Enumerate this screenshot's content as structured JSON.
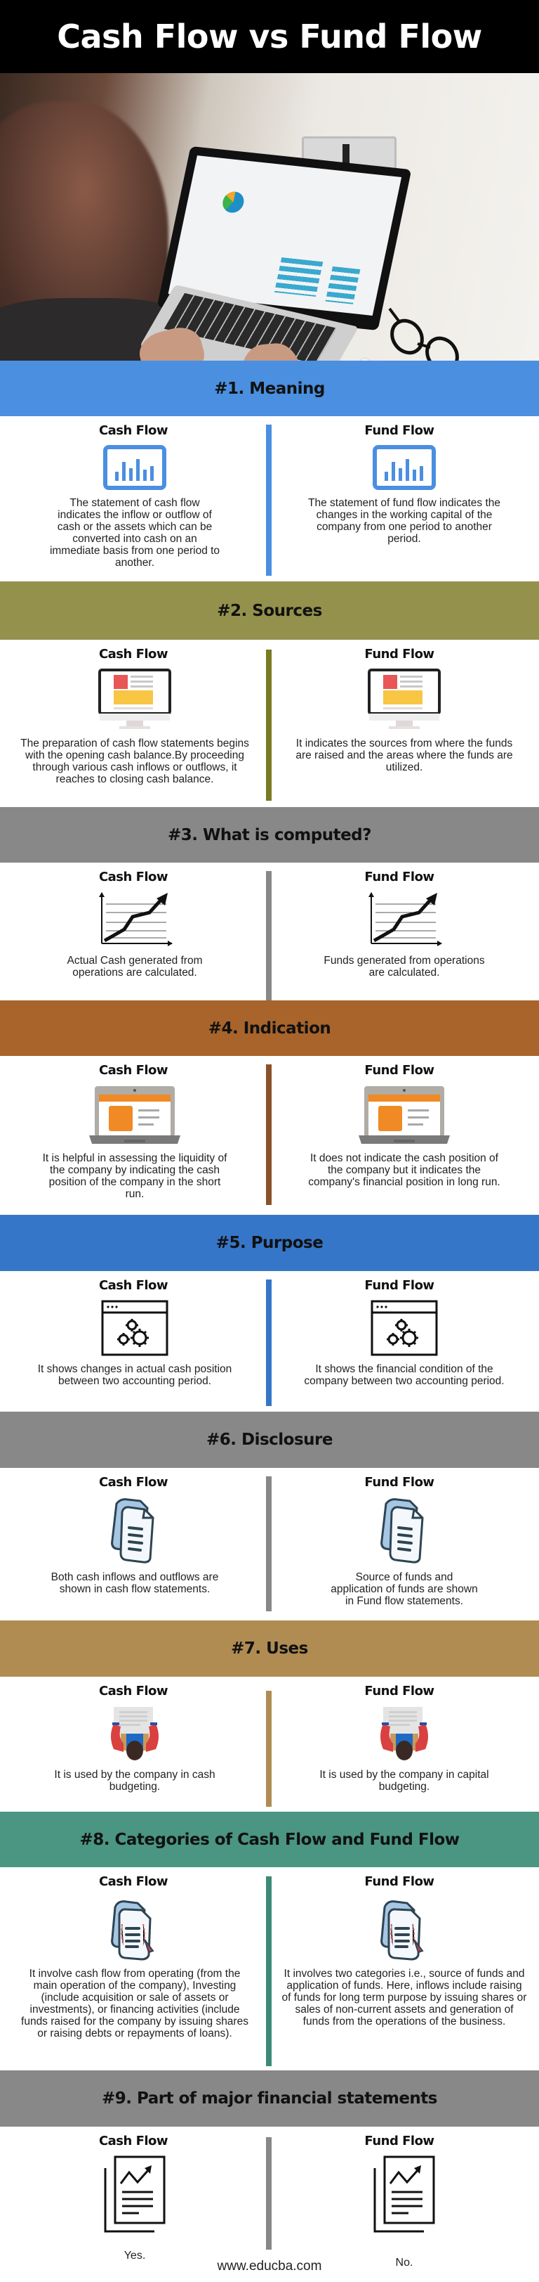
{
  "title": "Cash Flow vs Fund Flow",
  "photo": {
    "description": "person typing on laptop showing analytics dashboard",
    "icon": "hero-photo"
  },
  "column_titles": {
    "left": "Cash Flow",
    "right": "Fund Flow"
  },
  "sections": [
    {
      "heading": "#1. Meaning",
      "color": "#4a8fe0",
      "icon": "bar-chart-icon",
      "left_text": "The statement of cash flow indicates the inflow or outflow of cash or the assets which can be converted into cash on an immediate basis from one period to another.",
      "right_text": "The statement of fund flow indicates the changes in the working capital of the company from one period to another period."
    },
    {
      "heading": "#2. Sources",
      "color": "#94914c",
      "divider_color": "#7a7a22",
      "icon": "monitor-icon",
      "left_text": "The preparation of cash flow statements begins with the opening cash balance.By proceeding through various cash inflows or outflows, it reaches to closing cash balance.",
      "right_text": "It indicates the sources from where the funds are raised and the areas where the funds are utilized."
    },
    {
      "heading": "#3. What is computed?",
      "color": "#888888",
      "icon": "growth-chart-icon",
      "left_text": "Actual Cash generated from operations are calculated.",
      "right_text": "Funds generated from operations are calculated."
    },
    {
      "heading": "#4. Indication",
      "color": "#a8642a",
      "divider_color": "#8a5228",
      "icon": "laptop-icon",
      "left_text": "It is helpful in assessing the liquidity of the company by indicating the cash position of the company in the short run.",
      "right_text": "It does not indicate the cash position of the company but it indicates the company's financial position in long run."
    },
    {
      "heading": "#5. Purpose",
      "color": "#3576c8",
      "icon": "gears-window-icon",
      "left_text": "It shows changes in actual cash position between two accounting period.",
      "right_text": "It shows the financial condition of the company between two accounting period."
    },
    {
      "heading": "#6. Disclosure",
      "color": "#888888",
      "icon": "documents-icon",
      "left_text": "Both cash inflows and outflows are shown in cash flow statements.",
      "right_text": "Source of funds and application of funds are shown in Fund flow statements."
    },
    {
      "heading": "#7. Uses",
      "color": "#b08c52",
      "icon": "person-at-desk-icon",
      "left_text": "It is used by the company in cash budgeting.",
      "right_text": "It is used by the company in capital budgeting."
    },
    {
      "heading": "#8. Categories of Cash Flow and Fund Flow",
      "color": "#4a9682",
      "divider_color": "#3d8a78",
      "icon": "document-edit-icon",
      "left_text": "It involve cash flow from operating (from the main operation of the company), Investing (include acquisition or sale of assets or investments), or financing activities (include funds raised for the company by issuing shares or raising debts or repayments of loans).",
      "right_text": "It involves two categories i.e., source of funds and application of funds. Here, inflows include raising of funds for long term purpose by issuing shares or sales of non-current assets and generation of funds from the operations of the business."
    },
    {
      "heading": "#9. Part of major financial statements",
      "color": "#888888",
      "icon": "report-icon",
      "left_text": "Yes.",
      "right_text": "No."
    }
  ],
  "footer": {
    "url": "www.educba.com"
  }
}
